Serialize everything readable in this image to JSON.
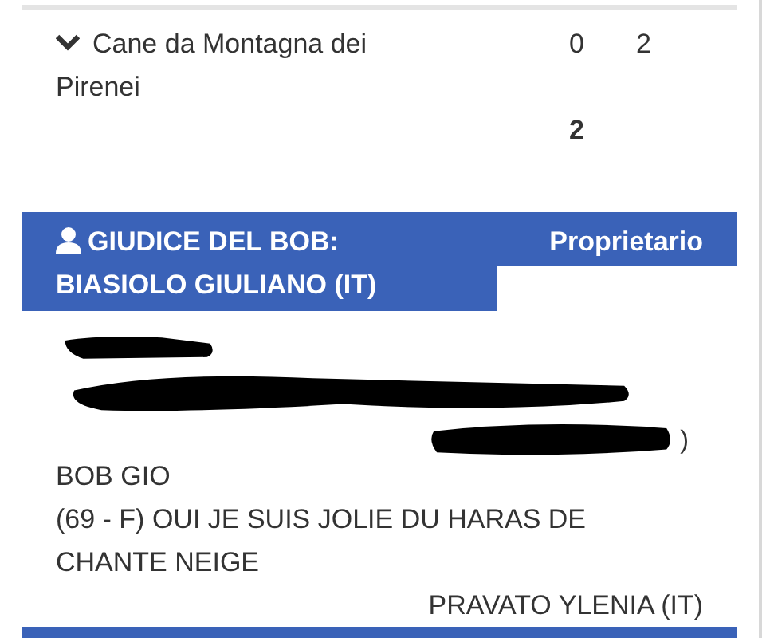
{
  "breed_row": {
    "expanded": true,
    "name": "Cane da Montagna dei Pirenei",
    "column_1": "0",
    "column_2": "2",
    "total": "2"
  },
  "judge_header": {
    "title": "GIUDICE DEL BOB: BIASIOLO GIULIANO (IT)",
    "owner_label": "Proprietario"
  },
  "entry": {
    "closing_mark": ")",
    "award": "BOB GIO",
    "dog": "(69 - F) OUI JE SUIS JOLIE DU HARAS DE CHANTE NEIGE",
    "owner": "PRAVATO YLENIA (IT)"
  }
}
